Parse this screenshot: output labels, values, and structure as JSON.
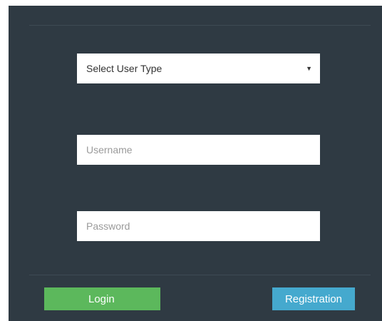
{
  "form": {
    "user_type": {
      "selected": "Select User Type",
      "caret_icon": "chevron-down-icon"
    },
    "username": {
      "value": "",
      "placeholder": "Username"
    },
    "password": {
      "value": "",
      "placeholder": "Password"
    }
  },
  "actions": {
    "login_label": "Login",
    "registration_label": "Registration"
  },
  "colors": {
    "panel_background": "#2f3a43",
    "login_button": "#5cb85c",
    "registration_button": "#45a9ce"
  }
}
